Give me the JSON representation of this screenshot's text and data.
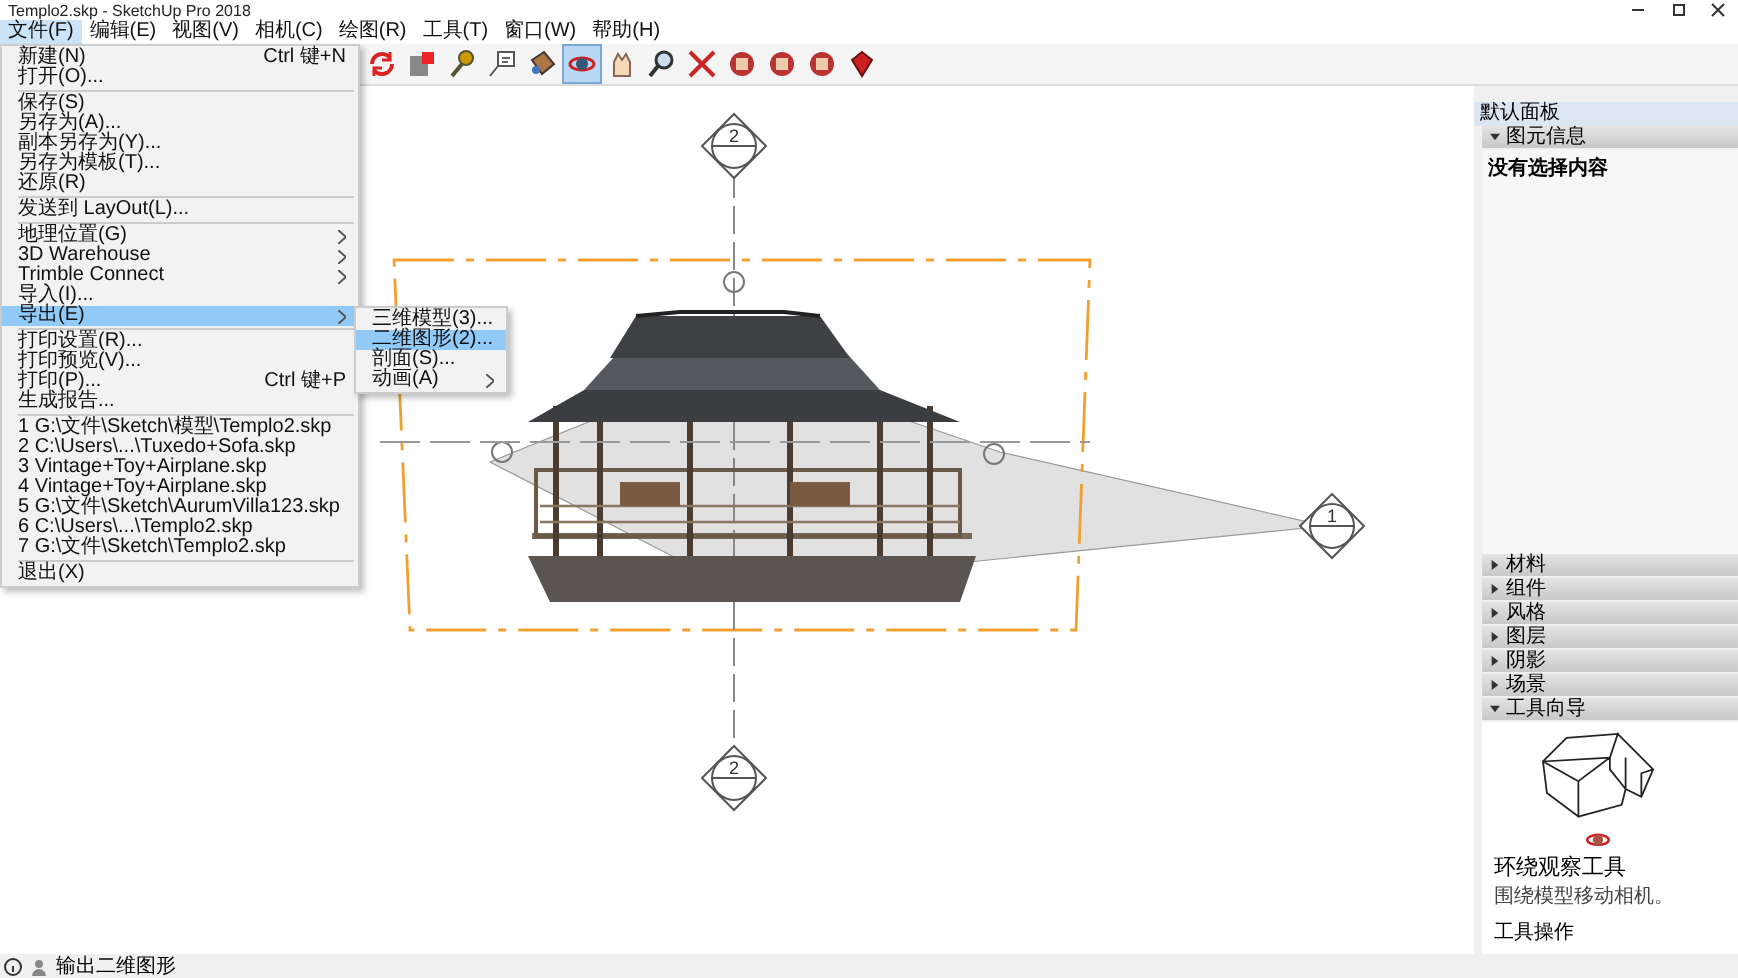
{
  "window": {
    "title": "Templo2.skp - SketchUp Pro 2018"
  },
  "menu_bar": [
    {
      "label": "文件(F)",
      "selected": true
    },
    {
      "label": "编辑(E)",
      "selected": false
    },
    {
      "label": "视图(V)",
      "selected": false
    },
    {
      "label": "相机(C)",
      "selected": false
    },
    {
      "label": "绘图(R)",
      "selected": false
    },
    {
      "label": "工具(T)",
      "selected": false
    },
    {
      "label": "窗口(W)",
      "selected": false
    },
    {
      "label": "帮助(H)",
      "selected": false
    }
  ],
  "toolbar": [
    {
      "kind": "rotate",
      "selected": false
    },
    {
      "kind": "box",
      "selected": false
    },
    {
      "kind": "tape",
      "selected": false
    },
    {
      "kind": "text",
      "selected": false
    },
    {
      "kind": "bucket",
      "selected": false
    },
    {
      "kind": "orbit",
      "selected": true
    },
    {
      "kind": "hand",
      "selected": false
    },
    {
      "kind": "zoom",
      "selected": false
    },
    {
      "kind": "extents",
      "selected": false
    },
    {
      "kind": "warehouse",
      "selected": false
    },
    {
      "kind": "warehouse",
      "selected": false
    },
    {
      "kind": "warehouse",
      "selected": false
    },
    {
      "kind": "gem",
      "selected": false
    }
  ],
  "file_menu": [
    {
      "kind": "item",
      "label": "新建(N)",
      "shortcut": "Ctrl 键+N",
      "has_submenu": false,
      "selected": false
    },
    {
      "kind": "item",
      "label": "打开(O)...",
      "has_submenu": false,
      "selected": false
    },
    {
      "kind": "separator"
    },
    {
      "kind": "item",
      "label": "保存(S)",
      "has_submenu": false,
      "selected": false
    },
    {
      "kind": "item",
      "label": "另存为(A)...",
      "has_submenu": false,
      "selected": false
    },
    {
      "kind": "item",
      "label": "副本另存为(Y)...",
      "has_submenu": false,
      "selected": false
    },
    {
      "kind": "item",
      "label": "另存为模板(T)...",
      "has_submenu": false,
      "selected": false
    },
    {
      "kind": "item",
      "label": "还原(R)",
      "has_submenu": false,
      "selected": false
    },
    {
      "kind": "separator"
    },
    {
      "kind": "item",
      "label": "发送到 LayOut(L)...",
      "has_submenu": false,
      "selected": false
    },
    {
      "kind": "separator"
    },
    {
      "kind": "item",
      "label": "地理位置(G)",
      "has_submenu": true,
      "selected": false
    },
    {
      "kind": "item",
      "label": "3D Warehouse",
      "has_submenu": true,
      "selected": false
    },
    {
      "kind": "item",
      "label": "Trimble Connect",
      "has_submenu": true,
      "selected": false
    },
    {
      "kind": "item",
      "label": "导入(I)...",
      "has_submenu": false,
      "selected": false
    },
    {
      "kind": "item",
      "label": "导出(E)",
      "has_submenu": true,
      "selected": true
    },
    {
      "kind": "separator"
    },
    {
      "kind": "item",
      "label": "打印设置(R)...",
      "has_submenu": false,
      "selected": false
    },
    {
      "kind": "item",
      "label": "打印预览(V)...",
      "has_submenu": false,
      "selected": false
    },
    {
      "kind": "item",
      "label": "打印(P)...",
      "shortcut": "Ctrl 键+P",
      "has_submenu": false,
      "selected": false
    },
    {
      "kind": "item",
      "label": "生成报告...",
      "has_submenu": false,
      "selected": false
    },
    {
      "kind": "separator"
    },
    {
      "kind": "item",
      "label": "1 G:\\文件\\Sketch\\模型\\Templo2.skp",
      "has_submenu": false,
      "selected": false
    },
    {
      "kind": "item",
      "label": "2 C:\\Users\\...\\Tuxedo+Sofa.skp",
      "has_submenu": false,
      "selected": false
    },
    {
      "kind": "item",
      "label": "3 Vintage+Toy+Airplane.skp",
      "has_submenu": false,
      "selected": false
    },
    {
      "kind": "item",
      "label": "4 Vintage+Toy+Airplane.skp",
      "has_submenu": false,
      "selected": false
    },
    {
      "kind": "item",
      "label": "5 G:\\文件\\Sketch\\AurumVilla123.skp",
      "has_submenu": false,
      "selected": false
    },
    {
      "kind": "item",
      "label": "6 C:\\Users\\...\\Templo2.skp",
      "has_submenu": false,
      "selected": false
    },
    {
      "kind": "item",
      "label": "7 G:\\文件\\Sketch\\Templo2.skp",
      "has_submenu": false,
      "selected": false
    },
    {
      "kind": "separator"
    },
    {
      "kind": "item",
      "label": "退出(X)",
      "has_submenu": false,
      "selected": false
    }
  ],
  "export_submenu": [
    {
      "label": "三维模型(3)...",
      "has_submenu": false,
      "selected": false
    },
    {
      "label": "二维图形(2)...",
      "has_submenu": false,
      "selected": true
    },
    {
      "label": "剖面(S)...",
      "has_submenu": false,
      "selected": false
    },
    {
      "label": "动画(A)",
      "has_submenu": true,
      "selected": false
    }
  ],
  "canvas": {
    "section_markers": [
      {
        "label": "2"
      },
      {
        "label": "1"
      },
      {
        "label": "2"
      }
    ]
  },
  "tray": {
    "title": "默认面板",
    "panels": [
      {
        "label": "图元信息",
        "expanded": true,
        "content": "没有选择内容"
      },
      {
        "label": "材料",
        "expanded": false
      },
      {
        "label": "组件",
        "expanded": false
      },
      {
        "label": "风格",
        "expanded": false
      },
      {
        "label": "图层",
        "expanded": false
      },
      {
        "label": "阴影",
        "expanded": false
      },
      {
        "label": "场景",
        "expanded": false
      },
      {
        "label": "工具向导",
        "expanded": true,
        "guide": {
          "title": "环绕观察工具",
          "description": "围绕模型移动相机。",
          "section": "工具操作"
        }
      }
    ]
  },
  "status_bar": {
    "text": "输出二维图形"
  }
}
